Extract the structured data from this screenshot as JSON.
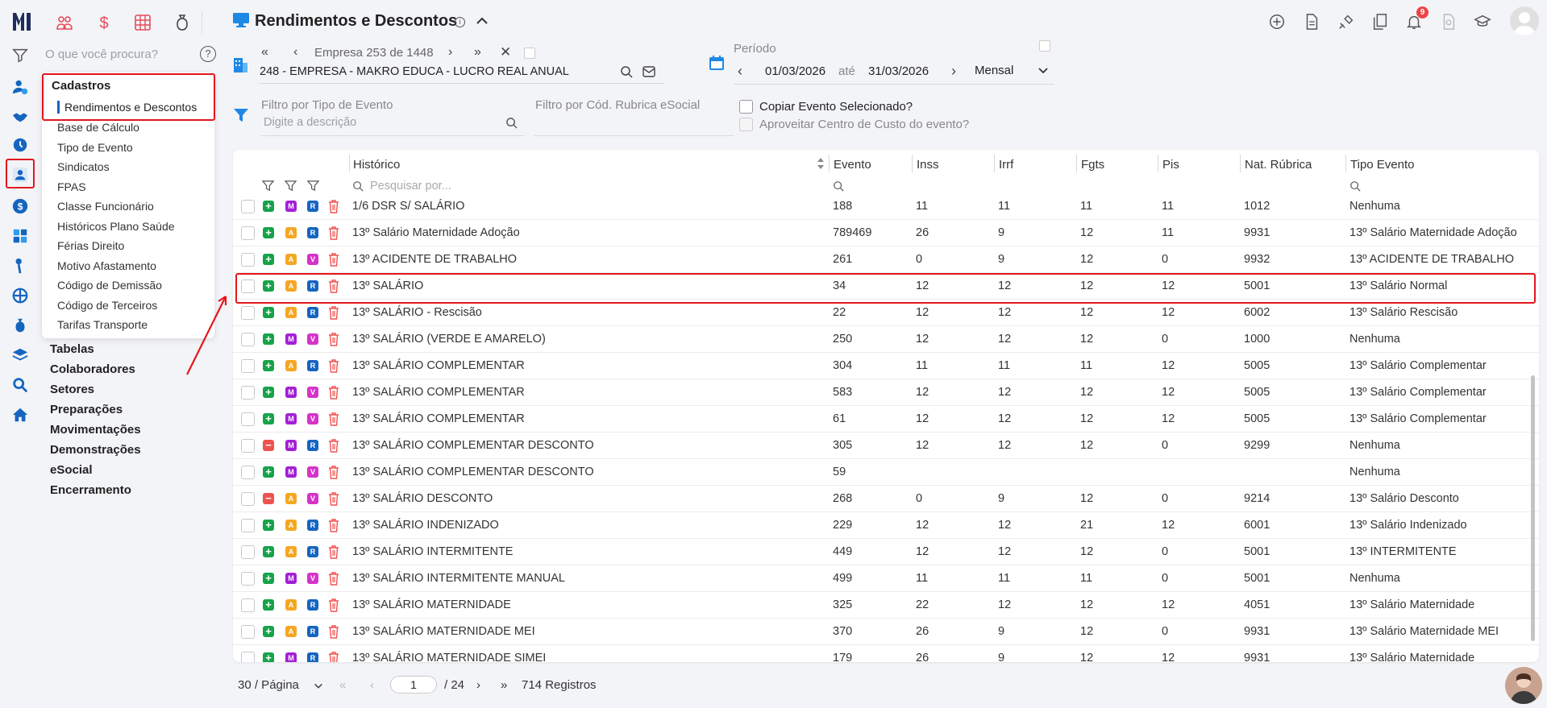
{
  "header": {
    "title": "Rendimentos e Descontos",
    "notifications_count": "9"
  },
  "company": {
    "pager_text": "Empresa 253 de 1448",
    "name": "248 - EMPRESA - MAKRO EDUCA - LUCRO REAL ANUAL"
  },
  "period": {
    "label": "Período",
    "start": "01/03/2026",
    "until_label": "até",
    "end": "31/03/2026",
    "frequency": "Mensal"
  },
  "filters": {
    "event_type_label": "Filtro por Tipo de Evento",
    "event_type_placeholder": "Digite a descrição",
    "rubrica_label": "Filtro por Cód. Rubrica eSocial",
    "copy_event_label": "Copiar Evento Selecionado?",
    "cost_center_label": "Aproveitar Centro de Custo do evento?"
  },
  "sidebar": {
    "search_placeholder": "O que você procura?",
    "panel_title": "Cadastros",
    "active_item": "Rendimentos e Descontos",
    "sub_items": [
      "Base de Cálculo",
      "Tipo de Evento",
      "Sindicatos",
      "FPAS",
      "Classe Funcionário",
      "Históricos Plano Saúde",
      "Férias Direito",
      "Motivo Afastamento",
      "Código de Demissão",
      "Código de Terceiros",
      "Tarifas Transporte"
    ],
    "main_items": [
      "Tabelas",
      "Colaboradores",
      "Setores",
      "Preparações",
      "Movimentações",
      "Demonstrações",
      "eSocial",
      "Encerramento"
    ]
  },
  "table": {
    "columns": [
      "Histórico",
      "Evento",
      "Inss",
      "Irrf",
      "Fgts",
      "Pis",
      "Nat. Rúbrica",
      "Tipo Evento"
    ],
    "search_placeholder": "Pesquisar por...",
    "rows": [
      {
        "sign": "+",
        "b1": "M",
        "b2": "R",
        "hist": "1/6 DSR S/ SALÁRIO",
        "evento": "188",
        "inss": "11",
        "irrf": "11",
        "fgts": "11",
        "pis": "11",
        "nat": "1012",
        "tipo": "Nenhuma"
      },
      {
        "sign": "+",
        "b1": "A",
        "b2": "R",
        "hist": "13º Salário Maternidade Adoção",
        "evento": "789469",
        "inss": "26",
        "irrf": "9",
        "fgts": "12",
        "pis": "11",
        "nat": "9931",
        "tipo": "13º Salário Maternidade Adoção"
      },
      {
        "sign": "+",
        "b1": "A",
        "b2": "V",
        "hist": "13º ACIDENTE DE TRABALHO",
        "evento": "261",
        "inss": "0",
        "irrf": "9",
        "fgts": "12",
        "pis": "0",
        "nat": "9932",
        "tipo": "13º ACIDENTE DE TRABALHO"
      },
      {
        "sign": "+",
        "b1": "A",
        "b2": "R",
        "hist": "13º SALÁRIO",
        "evento": "34",
        "inss": "12",
        "irrf": "12",
        "fgts": "12",
        "pis": "12",
        "nat": "5001",
        "tipo": "13º Salário Normal"
      },
      {
        "sign": "+",
        "b1": "A",
        "b2": "R",
        "hist": "13º SALÁRIO - Rescisão",
        "evento": "22",
        "inss": "12",
        "irrf": "12",
        "fgts": "12",
        "pis": "12",
        "nat": "6002",
        "tipo": "13º Salário Rescisão"
      },
      {
        "sign": "+",
        "b1": "M",
        "b2": "V",
        "hist": "13º SALÁRIO (VERDE E AMARELO)",
        "evento": "250",
        "inss": "12",
        "irrf": "12",
        "fgts": "12",
        "pis": "0",
        "nat": "1000",
        "tipo": "Nenhuma"
      },
      {
        "sign": "+",
        "b1": "A",
        "b2": "R",
        "hist": "13º SALÁRIO COMPLEMENTAR",
        "evento": "304",
        "inss": "11",
        "irrf": "11",
        "fgts": "11",
        "pis": "12",
        "nat": "5005",
        "tipo": "13º Salário Complementar"
      },
      {
        "sign": "+",
        "b1": "M",
        "b2": "V",
        "hist": "13º SALÁRIO COMPLEMENTAR",
        "evento": "583",
        "inss": "12",
        "irrf": "12",
        "fgts": "12",
        "pis": "12",
        "nat": "5005",
        "tipo": "13º Salário Complementar"
      },
      {
        "sign": "+",
        "b1": "M",
        "b2": "V",
        "hist": "13º SALÁRIO COMPLEMENTAR",
        "evento": "61",
        "inss": "12",
        "irrf": "12",
        "fgts": "12",
        "pis": "12",
        "nat": "5005",
        "tipo": "13º Salário Complementar"
      },
      {
        "sign": "-",
        "b1": "M",
        "b2": "R",
        "hist": "13º SALÁRIO COMPLEMENTAR DESCONTO",
        "evento": "305",
        "inss": "12",
        "irrf": "12",
        "fgts": "12",
        "pis": "0",
        "nat": "9299",
        "tipo": "Nenhuma"
      },
      {
        "sign": "+",
        "b1": "M",
        "b2": "V",
        "hist": "13º SALÁRIO COMPLEMENTAR DESCONTO",
        "evento": "59",
        "inss": "",
        "irrf": "",
        "fgts": "",
        "pis": "",
        "nat": "",
        "tipo": "Nenhuma"
      },
      {
        "sign": "-",
        "b1": "A",
        "b2": "V",
        "hist": "13º SALÁRIO DESCONTO",
        "evento": "268",
        "inss": "0",
        "irrf": "9",
        "fgts": "12",
        "pis": "0",
        "nat": "9214",
        "tipo": "13º Salário Desconto"
      },
      {
        "sign": "+",
        "b1": "A",
        "b2": "R",
        "hist": "13º SALÁRIO INDENIZADO",
        "evento": "229",
        "inss": "12",
        "irrf": "12",
        "fgts": "21",
        "pis": "12",
        "nat": "6001",
        "tipo": "13º Salário Indenizado"
      },
      {
        "sign": "+",
        "b1": "A",
        "b2": "R",
        "hist": "13º SALÁRIO INTERMITENTE",
        "evento": "449",
        "inss": "12",
        "irrf": "12",
        "fgts": "12",
        "pis": "0",
        "nat": "5001",
        "tipo": "13º INTERMITENTE"
      },
      {
        "sign": "+",
        "b1": "M",
        "b2": "V",
        "hist": "13º SALÁRIO INTERMITENTE MANUAL",
        "evento": "499",
        "inss": "11",
        "irrf": "11",
        "fgts": "11",
        "pis": "0",
        "nat": "5001",
        "tipo": "Nenhuma"
      },
      {
        "sign": "+",
        "b1": "A",
        "b2": "R",
        "hist": "13º SALÁRIO MATERNIDADE",
        "evento": "325",
        "inss": "22",
        "irrf": "12",
        "fgts": "12",
        "pis": "12",
        "nat": "4051",
        "tipo": "13º Salário Maternidade"
      },
      {
        "sign": "+",
        "b1": "A",
        "b2": "R",
        "hist": "13º SALÁRIO MATERNIDADE MEI",
        "evento": "370",
        "inss": "26",
        "irrf": "9",
        "fgts": "12",
        "pis": "0",
        "nat": "9931",
        "tipo": "13º Salário Maternidade MEI"
      },
      {
        "sign": "+",
        "b1": "M",
        "b2": "R",
        "hist": "13º SALÁRIO MATERNIDADE SIMEI",
        "evento": "179",
        "inss": "26",
        "irrf": "9",
        "fgts": "12",
        "pis": "12",
        "nat": "9931",
        "tipo": "13º Salário Maternidade"
      }
    ]
  },
  "pagination": {
    "per_page": "30 / Página",
    "current_page": "1",
    "total_pages": "/ 24",
    "total_records": "714 Registros"
  },
  "colors": {
    "accent": "#1565c0",
    "highlight": "#e3161c",
    "plus": "#16a34a",
    "minus": "#ef5350",
    "badge_M": "#a31fd6",
    "badge_A": "#f5a623",
    "badge_R": "#1565c0",
    "badge_V": "#d633c9"
  }
}
